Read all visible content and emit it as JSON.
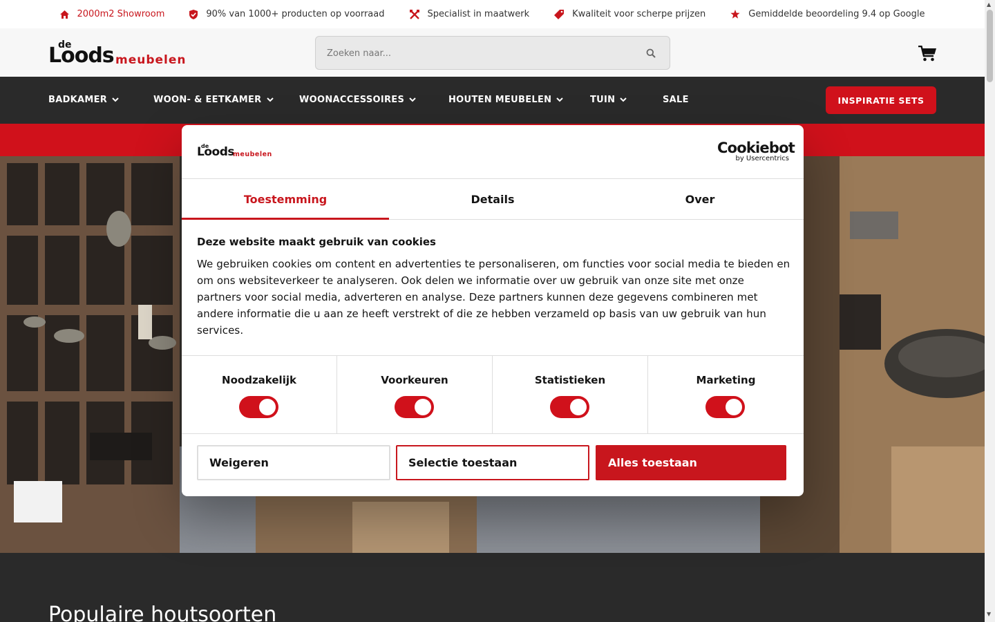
{
  "usp_bar": {
    "items": [
      {
        "label": "2000m2 Showroom",
        "icon": "home-icon"
      },
      {
        "label": "90% van 1000+ producten op voorraad",
        "icon": "shield-check-icon"
      },
      {
        "label": "Specialist in maatwerk",
        "icon": "tools-icon"
      },
      {
        "label": "Kwaliteit voor scherpe prijzen",
        "icon": "tag-icon"
      },
      {
        "label": "Gemiddelde beoordeling 9.4 op Google",
        "icon": "star-icon"
      }
    ]
  },
  "header": {
    "logo": {
      "de": "de",
      "loods": "Loods",
      "meubelen": "meubelen"
    },
    "search_placeholder": "Zoeken naar...",
    "cart_icon": "shopping-cart-icon"
  },
  "nav": {
    "items": [
      {
        "label": "BADKAMER"
      },
      {
        "label": "WOON- & EETKAMER"
      },
      {
        "label": "WOONACCESSOIRES"
      },
      {
        "label": "HOUTEN MEUBELEN"
      },
      {
        "label": "TUIN"
      },
      {
        "label": "SALE"
      }
    ],
    "cta_label": "INSPIRATIE SETS"
  },
  "section": {
    "title": "Populaire houtsoorten"
  },
  "cookie_dialog": {
    "brand_name": "Cookiebot",
    "brand_by": "by Usercentrics",
    "tabs": [
      {
        "label": "Toestemming",
        "active": true
      },
      {
        "label": "Details",
        "active": false
      },
      {
        "label": "Over",
        "active": false
      }
    ],
    "heading": "Deze website maakt gebruik van cookies",
    "body": "We gebruiken cookies om content en advertenties te personaliseren, om functies voor social media te bieden en om ons websiteverkeer te analyseren. Ook delen we informatie over uw gebruik van onze site met onze partners voor social media, adverteren en analyse. Deze partners kunnen deze gegevens combineren met andere informatie die u aan ze heeft verstrekt of die ze hebben verzameld op basis van uw gebruik van hun services.",
    "toggles": [
      {
        "label": "Noodzakelijk",
        "on": true
      },
      {
        "label": "Voorkeuren",
        "on": true
      },
      {
        "label": "Statistieken",
        "on": true
      },
      {
        "label": "Marketing",
        "on": true
      }
    ],
    "buttons": {
      "deny": "Weigeren",
      "selection": "Selectie toestaan",
      "allow_all": "Alles toestaan"
    }
  },
  "colors": {
    "brand_red": "#d0111b",
    "nav_bg": "#2a2a2a",
    "header_bg": "#f7f7f7"
  }
}
